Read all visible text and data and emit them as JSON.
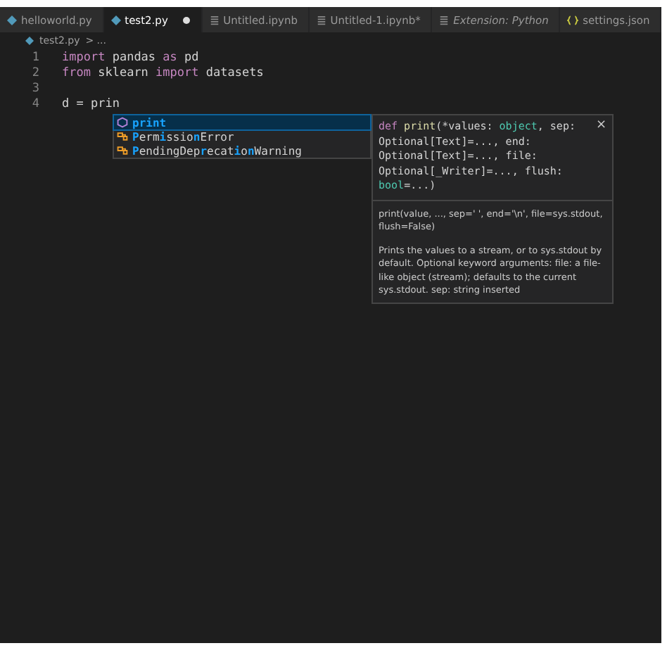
{
  "tabs": [
    {
      "label": "helloworld.py",
      "kind": "python",
      "selected": false,
      "italic": false
    },
    {
      "label": "test2.py",
      "kind": "python",
      "selected": true,
      "italic": false,
      "modified": true
    },
    {
      "label": "Untitled.ipynb",
      "kind": "notebook",
      "selected": false,
      "italic": false
    },
    {
      "label": "Untitled-1.ipynb*",
      "kind": "notebook",
      "selected": false,
      "italic": false
    },
    {
      "label": "Extension: Python",
      "kind": "notebook",
      "selected": false,
      "italic": true
    },
    {
      "label": "settings.json",
      "kind": "json",
      "selected": false,
      "italic": false
    }
  ],
  "breadcrumb": {
    "file": "test2.py",
    "rest": "> ..."
  },
  "code": [
    {
      "number": "1",
      "tokens": [
        {
          "text": "import",
          "kind": "keyword"
        },
        {
          "text": " pandas ",
          "kind": "plain"
        },
        {
          "text": "as",
          "kind": "keyword"
        },
        {
          "text": " pd",
          "kind": "plain"
        }
      ]
    },
    {
      "number": "2",
      "tokens": [
        {
          "text": "from",
          "kind": "keyword"
        },
        {
          "text": " sklearn ",
          "kind": "plain"
        },
        {
          "text": "import",
          "kind": "keyword"
        },
        {
          "text": " datasets",
          "kind": "plain"
        }
      ]
    },
    {
      "number": "3"
    },
    {
      "number": "4",
      "tokens": [
        {
          "text": "d = prin",
          "kind": "plain"
        }
      ]
    }
  ],
  "suggestions": [
    {
      "kind": "function",
      "selected": true,
      "parts": [
        {
          "text": "print",
          "match": true
        }
      ]
    },
    {
      "kind": "class",
      "selected": false,
      "parts": [
        {
          "text": "P",
          "match": true
        },
        {
          "text": "erm",
          "match": false
        },
        {
          "text": "i",
          "match": true
        },
        {
          "text": "ssio",
          "match": false
        },
        {
          "text": "n",
          "match": true
        },
        {
          "text": "Error",
          "match": false
        }
      ]
    },
    {
      "kind": "class",
      "selected": false,
      "parts": [
        {
          "text": "P",
          "match": true
        },
        {
          "text": "endingDep",
          "match": false
        },
        {
          "text": "r",
          "match": true
        },
        {
          "text": "ecat",
          "match": false
        },
        {
          "text": "i",
          "match": true
        },
        {
          "text": "o",
          "match": false
        },
        {
          "text": "n",
          "match": true
        },
        {
          "text": "Warning",
          "match": false
        }
      ]
    }
  ],
  "details": {
    "signature": [
      {
        "text": "def",
        "kind": "keyword"
      },
      {
        "text": " print",
        "kind": "function"
      },
      {
        "text": "(*values: ",
        "kind": "plain"
      },
      {
        "text": "object",
        "kind": "type"
      },
      {
        "text": ", sep: Optional[Text]=..., end: Optional[Text]=..., file: Optional[_Writer]=..., flush: ",
        "kind": "plain"
      },
      {
        "text": "bool",
        "kind": "type"
      },
      {
        "text": "=...)",
        "kind": "plain"
      }
    ],
    "close": "×",
    "usage": "print(value, ..., sep=' ', end='\\n', file=sys.stdout, flush=False)",
    "description": "Prints the values to a stream, or to sys.stdout by default. Optional keyword arguments: file: a file-like object (stream); defaults to the current sys.stdout. sep: string inserted"
  }
}
